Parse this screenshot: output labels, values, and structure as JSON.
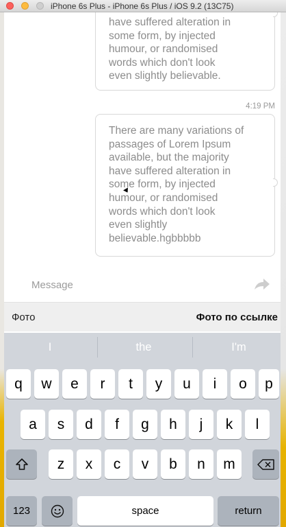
{
  "window": {
    "title": "iPhone 6s Plus - iPhone 6s Plus / iOS 9.2 (13C75)"
  },
  "chat": {
    "messages": [
      {
        "text": "have suffered alteration in\nsome form, by injected\nhumour, or randomised\nwords which don't look\neven slightly believable."
      },
      {
        "timestamp": "4:19 PM",
        "text": "There are many variations of\npassages of Lorem Ipsum\navailable, but the majority\nhave suffered alteration in\nsome form, by injected\nhumour, or randomised\nwords which don't look\neven slightly\nbelievable.hgbbbbb"
      }
    ]
  },
  "composer": {
    "placeholder": "Message",
    "send_icon": "send-arrow-icon"
  },
  "photo_bar": {
    "left_label": "Фото",
    "right_label": "Фото по ссылке"
  },
  "keyboard": {
    "suggestions": [
      "I",
      "the",
      "I'm"
    ],
    "row1": [
      "q",
      "w",
      "e",
      "r",
      "t",
      "y",
      "u",
      "i",
      "o",
      "p"
    ],
    "row2": [
      "a",
      "s",
      "d",
      "f",
      "g",
      "h",
      "j",
      "k",
      "l"
    ],
    "row3": [
      "z",
      "x",
      "c",
      "v",
      "b",
      "n",
      "m"
    ],
    "shift_icon": "shift-icon",
    "delete_icon": "delete-icon",
    "numbers_label": "123",
    "emoji_icon": "emoji-icon",
    "space_label": "space",
    "return_label": "return"
  }
}
